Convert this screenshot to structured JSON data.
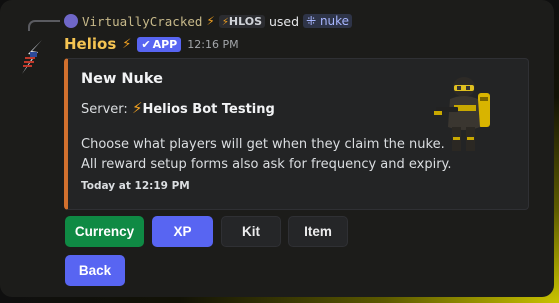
{
  "reply": {
    "username": "VirtuallyCracked",
    "guild_tag": "HLOS",
    "used_text": "used",
    "command": "nuke"
  },
  "message": {
    "bot_name": "Helios",
    "app_badge": "APP",
    "timestamp": "12:16 PM"
  },
  "embed": {
    "accent_color": "#d1702e",
    "title": "New Nuke",
    "server_label": "Server:",
    "server_name": "Helios Bot Testing",
    "description_line1": "Choose what players will get when they claim the nuke.",
    "description_line2": "All reward setup forms also ask for frequency and expiry.",
    "footer": "Today at 12:19 PM"
  },
  "buttons": {
    "currency": "Currency",
    "xp": "XP",
    "kit": "Kit",
    "item": "Item",
    "back": "Back"
  },
  "colors": {
    "success": "#0f8a44",
    "primary": "#5865f2",
    "secondary": "#252628"
  }
}
